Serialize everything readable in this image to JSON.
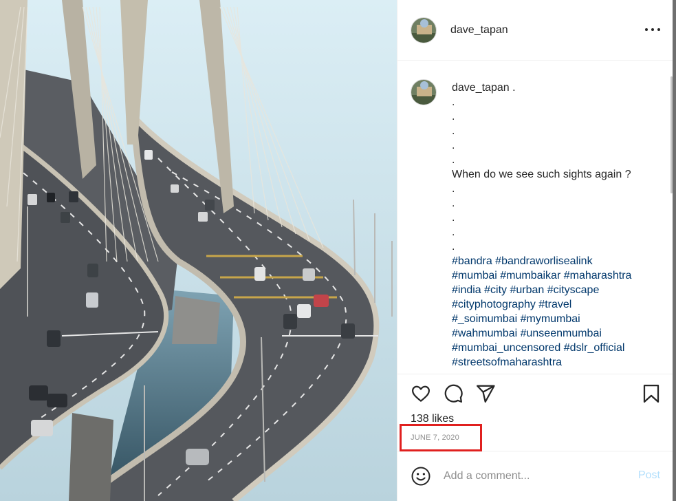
{
  "post": {
    "username": "dave_tapan",
    "more_icon": "more-horizontal-icon"
  },
  "caption": {
    "username": "dave_tapan",
    "suffix": " .",
    "lines": [
      ".",
      ".",
      ".",
      ".",
      ".",
      "When do we see such sights again ?",
      ".",
      ".",
      ".",
      ".",
      "."
    ],
    "hashtags": [
      "#bandra #bandraworlisealink",
      "#mumbai #mumbaikar #maharashtra",
      "#india #city #urban #cityscape",
      "#cityphotography #travel",
      "#_soimumbai #mymumbai",
      "#wahmumbai #unseenmumbai",
      "#mumbai_uncensored #dslr_official",
      "#streetsofmaharashtra"
    ]
  },
  "actions": {
    "like_icon": "heart-icon",
    "comment_icon": "comment-icon",
    "share_icon": "share-icon",
    "save_icon": "bookmark-icon",
    "likes": "138 likes",
    "date": "JUNE 7, 2020"
  },
  "comment": {
    "emoji_icon": "emoji-icon",
    "placeholder": "Add a comment...",
    "post_label": "Post"
  },
  "colors": {
    "link": "#00376b",
    "post_disabled": "#b2dffc",
    "highlight": "#e0201f"
  }
}
